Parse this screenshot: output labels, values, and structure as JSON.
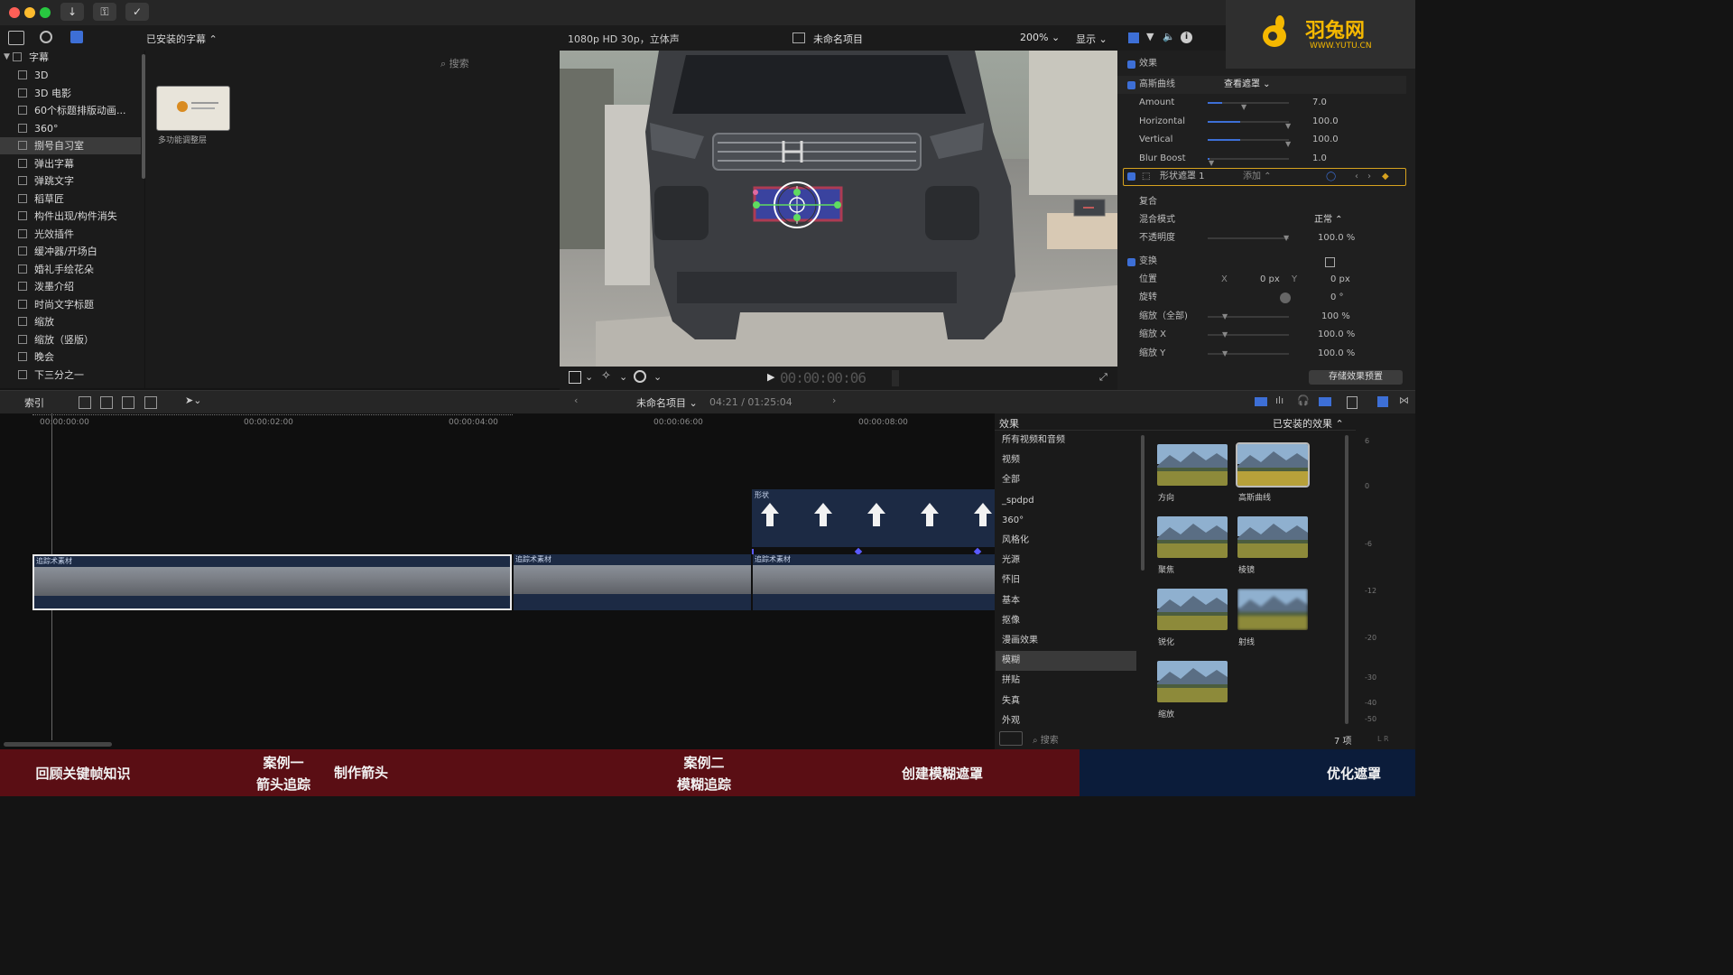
{
  "window": {
    "toolbar_icons": [
      "download-icon",
      "key-icon",
      "check-icon"
    ]
  },
  "logo": {
    "name": "羽兔网",
    "url": "WWW.YUTU.CN"
  },
  "library": {
    "installed_label": "已安装的字幕",
    "search_placeholder": "搜索",
    "tree_root": "字幕",
    "items": [
      "3D",
      "3D 电影",
      "60个标题排版动画...",
      "360°",
      "捌号自习室",
      "弹出字幕",
      "弹跳文字",
      "稻草匠",
      "构件出现/构件消失",
      "光效插件",
      "缓冲器/开场白",
      "婚礼手绘花朵",
      "泼墨介绍",
      "时尚文字标题",
      "缩放",
      "缩放（竖版）",
      "晚会",
      "下三分之一"
    ],
    "selected_index": 4,
    "browser_clip_label": "多功能调整层"
  },
  "viewer": {
    "format": "1080p HD 30p，立体声",
    "project": "未命名项目",
    "zoom": "200%",
    "display": "显示",
    "timecode": "00:00:00:06"
  },
  "inspector": {
    "effects_label": "效果",
    "gaussian": "高斯曲线",
    "view_mask": "查看遮罩",
    "params": [
      {
        "k": "Amount",
        "v": "7.0",
        "level": 0.45
      },
      {
        "k": "Horizontal",
        "v": "100.0",
        "level": 1.0
      },
      {
        "k": "Vertical",
        "v": "100.0",
        "level": 1.0
      },
      {
        "k": "Blur Boost",
        "v": "1.0",
        "level": 0.05
      }
    ],
    "shape_mask": "形状遮罩 1",
    "add_label": "添加",
    "composite": "复合",
    "blend_mode_k": "混合模式",
    "blend_mode_v": "正常",
    "opacity_k": "不透明度",
    "opacity_v": "100.0 %",
    "transform": "变换",
    "position_k": "位置",
    "pos_x_label": "X",
    "pos_x": "0 px",
    "pos_y_label": "Y",
    "pos_y": "0 px",
    "rotation_k": "旋转",
    "rotation_v": "0 °",
    "scale_all_k": "缩放（全部)",
    "scale_all_v": "100 %",
    "scale_x_k": "缩放 X",
    "scale_x_v": "100.0 %",
    "scale_y_k": "缩放 Y",
    "scale_y_v": "100.0 %",
    "save_preset": "存储效果预置"
  },
  "timeline": {
    "index_label": "索引",
    "project": "未命名项目",
    "duration": "04:21 / 01:25:04",
    "ruler": [
      "00:00:00:00",
      "00:00:02:00",
      "00:00:04:00",
      "00:00:06:00",
      "00:00:08:00"
    ],
    "shape_label": "形状",
    "clip_labels": [
      "追踪术素材",
      "追踪术素材",
      "追踪术素材"
    ]
  },
  "effects": {
    "title": "效果",
    "installed": "已安装的效果",
    "categories": [
      "所有视频和音频",
      "视频",
      "全部",
      "_spdpd",
      "360°",
      "风格化",
      "光源",
      "怀旧",
      "基本",
      "抠像",
      "漫画效果",
      "模糊",
      "拼贴",
      "失真",
      "外观"
    ],
    "selected_category": 11,
    "thumbs": [
      "方向",
      "高斯曲线",
      "聚焦",
      "棱镜",
      "锐化",
      "射线",
      "缩放"
    ],
    "count": "7 项",
    "search_placeholder": "搜索"
  },
  "meter": {
    "ticks": [
      "6",
      "0",
      "-6",
      "-12",
      "-20",
      "-30",
      "-40",
      "-50"
    ],
    "lr": "L  R"
  },
  "bottom": {
    "steps": [
      "回顾关键帧知识",
      "案例一",
      "箭头追踪",
      "制作箭头",
      "案例二",
      "模糊追踪",
      "创建模糊遮罩",
      "优化遮罩"
    ]
  }
}
